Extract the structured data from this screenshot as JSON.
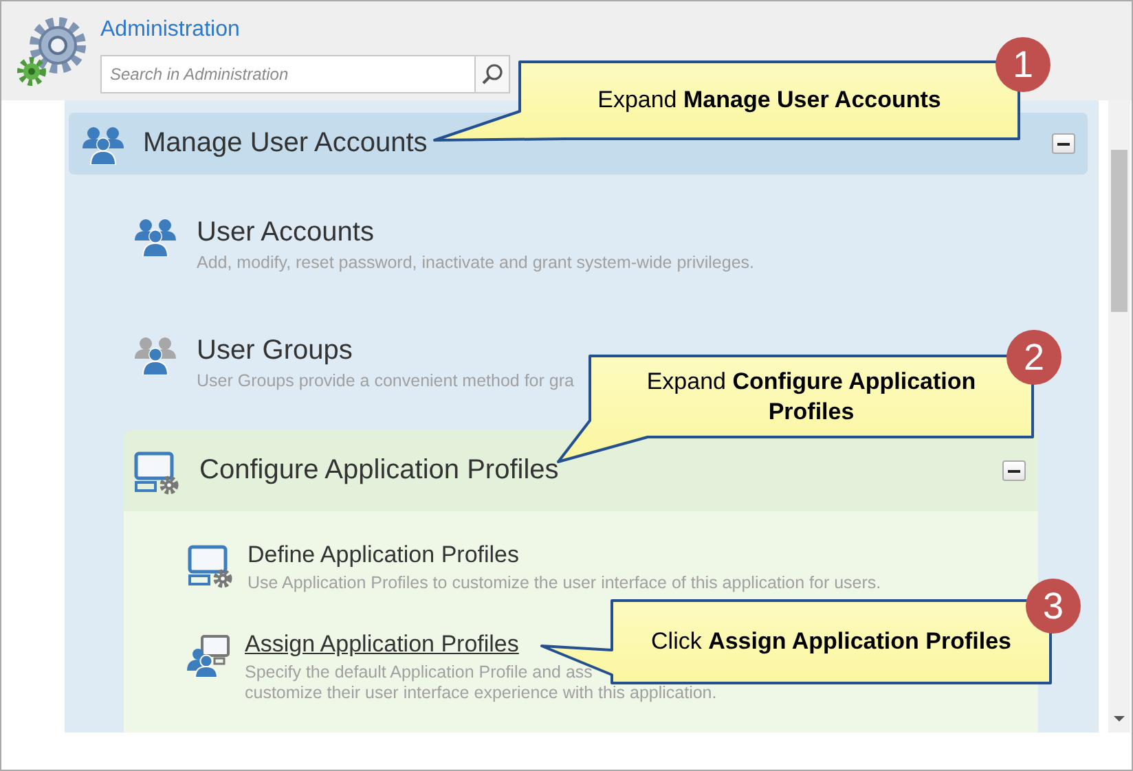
{
  "window": {
    "title": "Administration"
  },
  "search": {
    "placeholder": "Search in Administration"
  },
  "sections": [
    {
      "title": "Manage User Accounts",
      "expanded": true,
      "items": [
        {
          "kind": "item",
          "title": "User Accounts",
          "hovered": false,
          "description_lines": [
            "Add, modify, reset password, inactivate and grant system-wide privileges."
          ]
        },
        {
          "kind": "item",
          "title": "User Groups",
          "hovered": false,
          "description_lines": [
            "User Groups  provide a convenient method for gra"
          ]
        },
        {
          "kind": "section",
          "title": "Configure Application Profiles",
          "expanded": true,
          "items": [
            {
              "kind": "item",
              "title": "Define Application Profiles",
              "hovered": false,
              "description_lines": [
                "Use Application Profiles to customize the user interface of this application for users."
              ]
            },
            {
              "kind": "item",
              "title": "Assign Application Profiles",
              "hovered": true,
              "description_lines": [
                "Specify the default Application Profile and ass",
                "customize their user interface experience with this application."
              ]
            }
          ]
        }
      ]
    }
  ],
  "callouts": [
    {
      "step": "1",
      "text": "Expand **Manage User Accounts**"
    },
    {
      "step": "2",
      "text": "Expand **Configure Application Profiles**"
    },
    {
      "step": "3",
      "text": "Click **Assign Application Profiles**"
    }
  ]
}
